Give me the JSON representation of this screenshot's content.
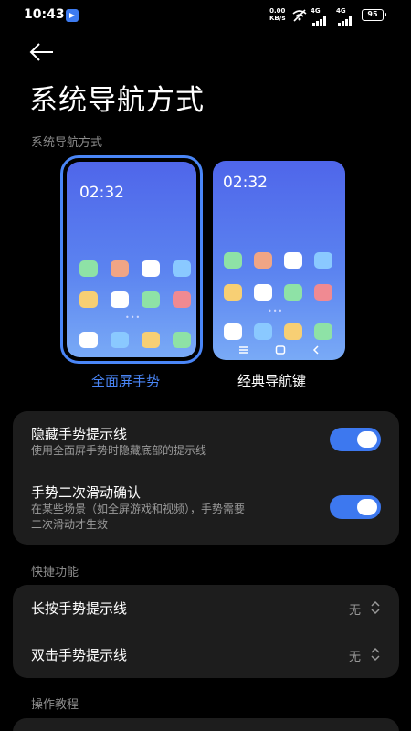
{
  "status_bar": {
    "time": "10:43",
    "net_speed_value": "0.00",
    "net_speed_unit": "KB/s",
    "signal_1_label": "4G",
    "signal_2_label": "4G",
    "battery": "95"
  },
  "header": {
    "title": "系统导航方式"
  },
  "navigation_section": {
    "label": "系统导航方式",
    "options": [
      {
        "label": "全面屏手势",
        "preview_time": "02:32",
        "selected": true
      },
      {
        "label": "经典导航键",
        "preview_time": "02:32",
        "selected": false
      }
    ]
  },
  "gesture_settings": {
    "items": [
      {
        "title": "隐藏手势提示线",
        "subtitle": "使用全面屏手势时隐藏底部的提示线",
        "enabled": true
      },
      {
        "title": "手势二次滑动确认",
        "subtitle_line1": "在某些场景（如全屏游戏和视频），手势需要",
        "subtitle_line2": "二次滑动才生效",
        "enabled": true
      }
    ]
  },
  "shortcut_section": {
    "label": "快捷功能",
    "items": [
      {
        "title": "长按手势提示线",
        "value": "无"
      },
      {
        "title": "双击手势提示线",
        "value": "无"
      }
    ]
  },
  "tutorial_section": {
    "label": "操作教程"
  },
  "colors": {
    "accent": "#3d78ef",
    "card_bg": "#1d1d1d",
    "background": "#000000",
    "secondary_text": "#9a9a9a"
  }
}
